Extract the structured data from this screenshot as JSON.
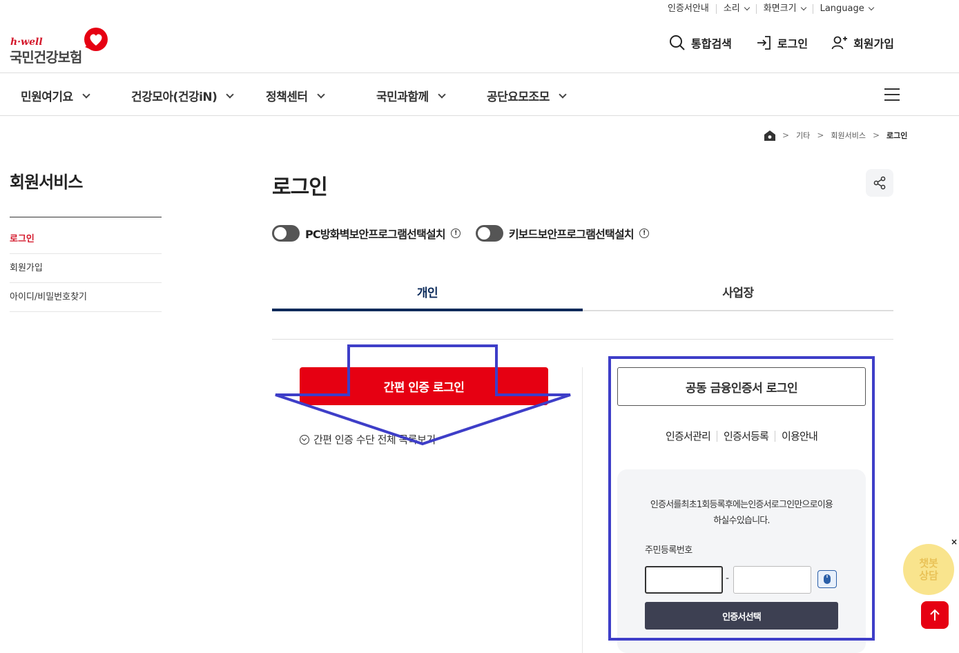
{
  "utility": {
    "items": [
      "인증서안내",
      "소리",
      "화면크기",
      "Language"
    ]
  },
  "logo": {
    "sub": "h·well",
    "main": "국민건강보험"
  },
  "header_actions": {
    "search": "통합검색",
    "login": "로그인",
    "signup": "회원가입"
  },
  "gnb": {
    "items": [
      "민원여기요",
      "건강모아(건강iN)",
      "정책센터",
      "국민과함께",
      "공단요모조모"
    ]
  },
  "breadcrumb": {
    "items": [
      "기타",
      "회원서비스",
      "로그인"
    ]
  },
  "side": {
    "title": "회원서비스",
    "items": [
      "로그인",
      "회원가입",
      "아이디/비밀번호찾기"
    ]
  },
  "page": {
    "title": "로그인"
  },
  "toggles": {
    "firewall": "PC방화벽보안프로그램선택설치",
    "keyboard": "키보드보안프로그램선택설치",
    "info_glyph": "!"
  },
  "tabs": {
    "personal": "개인",
    "business": "사업장"
  },
  "easy_login": {
    "button": "간편 인증 로그인",
    "more": "간편 인증 수단 전체 목록보기"
  },
  "cert_login": {
    "button": "공동 금융인증서 로그인",
    "links": [
      "인증서관리",
      "인증서등록",
      "이용안내"
    ],
    "info_line1": "인증서를최초1회등록후에는인증서로그인만으로이용",
    "info_line2": "하실수있습니다.",
    "rrn_label": "주민등록번호",
    "dash": "-",
    "select_button": "인증서선택"
  },
  "floating": {
    "chatbot_line1": "챗봇",
    "chatbot_line2": "상담",
    "close": "×"
  },
  "colors": {
    "brand_red": "#e60012",
    "navy": "#0b2a5a",
    "annotation": "#3e3ec8"
  }
}
